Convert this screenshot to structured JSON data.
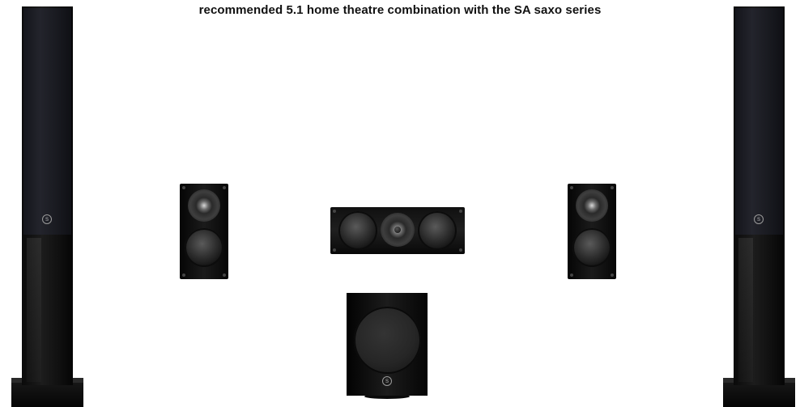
{
  "caption": "recommended 5.1 home theatre combination with the SA saxo series",
  "logo_mark": "S",
  "colors": {
    "background": "#ffffff",
    "speaker_finish": "#0d0d0d",
    "caption_text": "#111111"
  },
  "speakers": [
    {
      "name": "front-left-tower"
    },
    {
      "name": "surround-left-bookshelf"
    },
    {
      "name": "center-channel"
    },
    {
      "name": "surround-right-bookshelf"
    },
    {
      "name": "front-right-tower"
    },
    {
      "name": "subwoofer"
    }
  ]
}
